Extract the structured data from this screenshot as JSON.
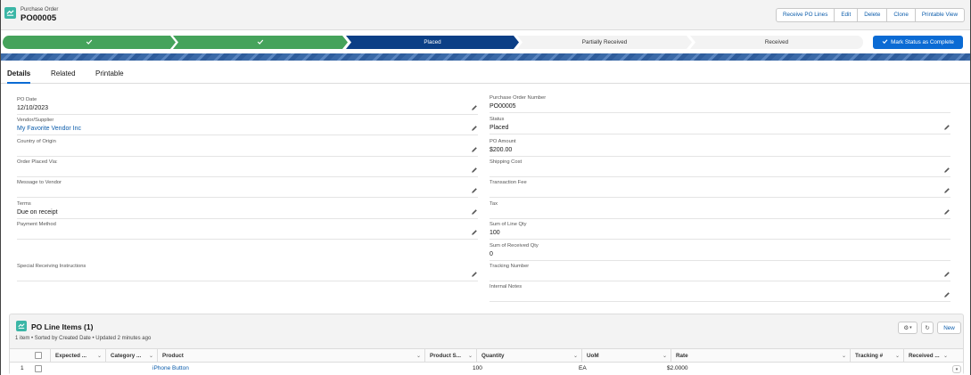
{
  "header": {
    "object_type": "Purchase Order",
    "record_name": "PO00005",
    "actions": [
      "Receive PO Lines",
      "Edit",
      "Delete",
      "Clone",
      "Printable View"
    ]
  },
  "path": {
    "steps": [
      {
        "label": "",
        "state": "complete"
      },
      {
        "label": "",
        "state": "complete"
      },
      {
        "label": "Placed",
        "state": "current"
      },
      {
        "label": "Partially Received",
        "state": "incomplete"
      },
      {
        "label": "Received",
        "state": "incomplete"
      }
    ],
    "mark_button": "Mark Status as Complete",
    "colors": {
      "complete": "#45a35b",
      "current": "#0b3f86",
      "incomplete": "#f3f3f3"
    }
  },
  "tabs": [
    "Details",
    "Related",
    "Printable"
  ],
  "active_tab": "Details",
  "left_fields": [
    {
      "label": "PO Date",
      "value": "12/10/2023"
    },
    {
      "label": "Vendor/Supplier",
      "value": "My Favorite Vendor Inc",
      "link": true
    },
    {
      "label": "Country of Origin",
      "value": ""
    },
    {
      "label": "Order Placed Via:",
      "value": ""
    },
    {
      "label": "Message to Vendor",
      "value": ""
    },
    {
      "label": "Terms",
      "value": "Due on receipt"
    },
    {
      "label": "Payment Method",
      "value": ""
    },
    {
      "label": "Special Receiving Instructions",
      "value": ""
    }
  ],
  "right_fields": [
    {
      "label": "Purchase Order Number",
      "value": "PO00005",
      "editable": false
    },
    {
      "label": "Status",
      "value": "Placed",
      "editable": true
    },
    {
      "label": "PO Amount",
      "value": "$200.00",
      "editable": false
    },
    {
      "label": "Shipping Cost",
      "value": "",
      "editable": true
    },
    {
      "label": "Transaction Fee",
      "value": "",
      "editable": true
    },
    {
      "label": "Tax",
      "value": "",
      "editable": true
    },
    {
      "label": "Sum of Line Qty",
      "value": "100",
      "editable": false
    },
    {
      "label": "Sum of Received Qty",
      "value": "0",
      "editable": false
    },
    {
      "label": "Tracking Number",
      "value": "",
      "editable": true
    },
    {
      "label": "Internal Notes",
      "value": "",
      "editable": true
    }
  ],
  "related": {
    "title": "PO Line Items (1)",
    "subtitle": "1 item • Sorted by Created Date • Updated 2 minutes ago",
    "new_button": "New",
    "columns": [
      "Expected ...",
      "Category ...",
      "Product",
      "Product S...",
      "Quantity",
      "UoM",
      "Rate",
      "Tracking #",
      "Received ..."
    ],
    "rows": [
      {
        "num": "1",
        "expected": "",
        "category": "",
        "product": "iPhone Button",
        "product_s": "",
        "quantity": "100",
        "uom": "EA",
        "rate": "$2.0000",
        "tracking": "",
        "received": ""
      }
    ]
  }
}
